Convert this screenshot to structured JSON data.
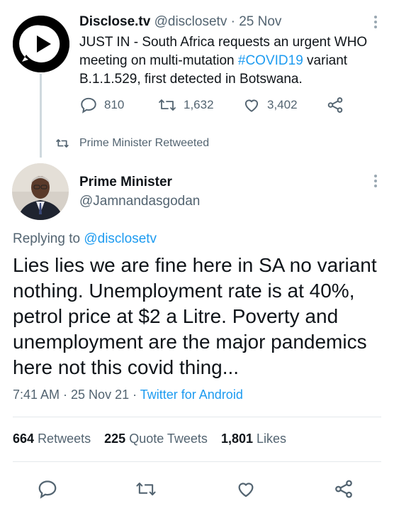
{
  "parent": {
    "name": "Disclose.tv",
    "handle": "@disclosetv",
    "time": "· 25 Nov",
    "text_prefix": "JUST IN - South Africa requests an urgent WHO meeting on multi-mutation ",
    "hashtag": "#COVID19",
    "text_suffix": " variant B.1.1.529, first detected in Botswana.",
    "replies": "810",
    "retweets": "1,632",
    "likes": "3,402"
  },
  "retweet_note": "Prime Minister Retweeted",
  "main": {
    "name": "Prime Minister",
    "handle": "@Jamnandasgodan",
    "replying_label": "Replying to",
    "replying_handle": "@disclosetv",
    "text": "Lies lies we are fine here in SA no variant nothing. Unemployment rate is at 40%, petrol price at $2 a Litre. Poverty and unemployment are the major pandemics here not this covid thing...",
    "time": "7:41 AM · 25 Nov 21 · ",
    "source": "Twitter for Android",
    "retweets_count": "664",
    "retweets_label": "Retweets",
    "quote_count": "225",
    "quote_label": "Quote Tweets",
    "likes_count": "1,801",
    "likes_label": "Likes"
  },
  "colors": {
    "accent": "#1d9bf0",
    "muted": "#536471",
    "text": "#0f1419"
  },
  "icons": [
    "play-logo-icon",
    "reply-icon",
    "retweet-icon",
    "like-icon",
    "share-icon",
    "more-icon"
  ]
}
